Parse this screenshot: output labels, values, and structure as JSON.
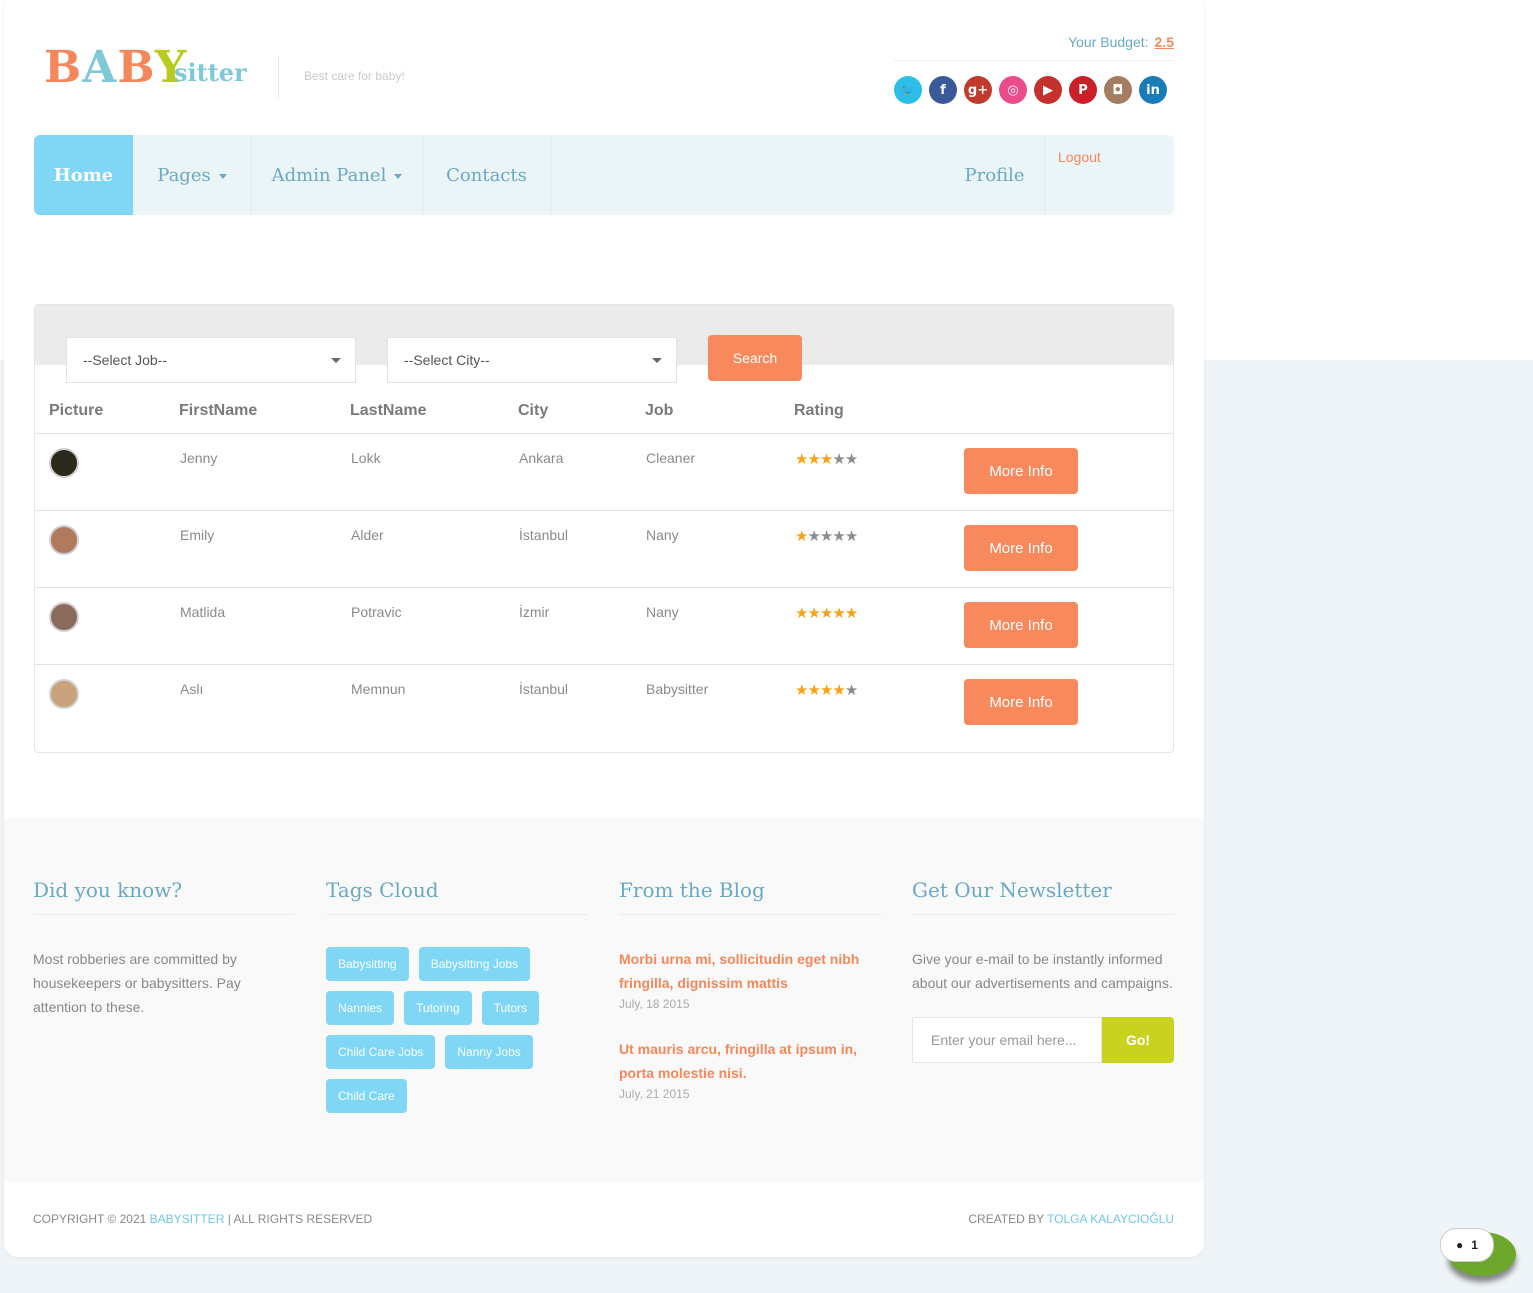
{
  "header": {
    "logo_parts": [
      "B",
      "A",
      "B",
      "Y"
    ],
    "logo_suffix": "sitter",
    "tagline": "Best care for baby!",
    "budget_label": "Your Budget:",
    "budget_value": "2.5",
    "social": [
      {
        "name": "twitter-icon",
        "glyph": "🐦",
        "color": "#2dbde9"
      },
      {
        "name": "facebook-icon",
        "glyph": "f",
        "color": "#3b5998"
      },
      {
        "name": "google-plus-icon",
        "glyph": "g+",
        "color": "#c23a2b"
      },
      {
        "name": "dribbble-icon",
        "glyph": "◎",
        "color": "#ea4c89"
      },
      {
        "name": "youtube-icon",
        "glyph": "▶",
        "color": "#c4302b"
      },
      {
        "name": "pinterest-icon",
        "glyph": "P",
        "color": "#cb2027"
      },
      {
        "name": "instagram-icon",
        "glyph": "◘",
        "color": "#a37d61"
      },
      {
        "name": "linkedin-icon",
        "glyph": "in",
        "color": "#1a7bb9"
      }
    ]
  },
  "nav": {
    "home": "Home",
    "pages": "Pages",
    "admin_panel": "Admin Panel",
    "contacts": "Contacts",
    "profile": "Profile",
    "logout": "Logout"
  },
  "search": {
    "job_select": "--Select Job--",
    "city_select": "--Select City--",
    "button": "Search"
  },
  "table": {
    "headers": [
      "Picture",
      "FirstName",
      "LastName",
      "City",
      "Job",
      "Rating"
    ],
    "rows": [
      {
        "first": "Jenny",
        "last": "Lokk",
        "city": "Ankara",
        "job": "Cleaner",
        "rating": 3,
        "avatar_color": "#2b2a1a",
        "button": "More Info"
      },
      {
        "first": "Emily",
        "last": "Alder",
        "city": "İstanbul",
        "job": "Nany",
        "rating": 1,
        "avatar_color": "#b07a5c",
        "button": "More Info"
      },
      {
        "first": "Matlida",
        "last": "Potravic",
        "city": "İzmir",
        "job": "Nany",
        "rating": 5,
        "avatar_color": "#8a6a5a",
        "button": "More Info"
      },
      {
        "first": "Aslı",
        "last": "Memnun",
        "city": "İstanbul",
        "job": "Babysitter",
        "rating": 4,
        "avatar_color": "#c9a37e",
        "button": "More Info"
      }
    ]
  },
  "footer": {
    "did_you_know": {
      "title": "Did you know?",
      "text": "Most robberies are committed by housekeepers or babysitters. Pay attention to these."
    },
    "tags": {
      "title": "Tags Cloud",
      "items": [
        "Babysitting",
        "Babysitting Jobs",
        "Nannies",
        "Tutoring",
        "Tutors",
        "Child Care Jobs",
        "Nanny Jobs",
        "Child Care"
      ]
    },
    "blog": {
      "title": "From the Blog",
      "posts": [
        {
          "title": "Morbi urna mi, sollicitudin eget nibh fringilla, dignissim mattis",
          "date": "July, 18 2015"
        },
        {
          "title": "Ut mauris arcu, fringilla at ipsum in, porta molestie nisi.",
          "date": "July, 21 2015"
        }
      ]
    },
    "newsletter": {
      "title": "Get Our Newsletter",
      "text": "Give your e-mail to be instantly informed about our advertisements and campaigns.",
      "placeholder": "Enter your email here...",
      "button": "Go!"
    },
    "copyright_prefix": "COPYRIGHT © 2021",
    "copyright_brand": "BABYSITTER",
    "copyright_suffix": "|  ALL RIGHTS RESERVED",
    "created_by": "CREATED BY",
    "author": "TOLGA KALAYCIOĞLU"
  },
  "chat": {
    "count": "1"
  },
  "colors": {
    "accent_orange": "#f8895c",
    "accent_blue": "#7fd6f5",
    "go_green": "#c9d21e"
  }
}
